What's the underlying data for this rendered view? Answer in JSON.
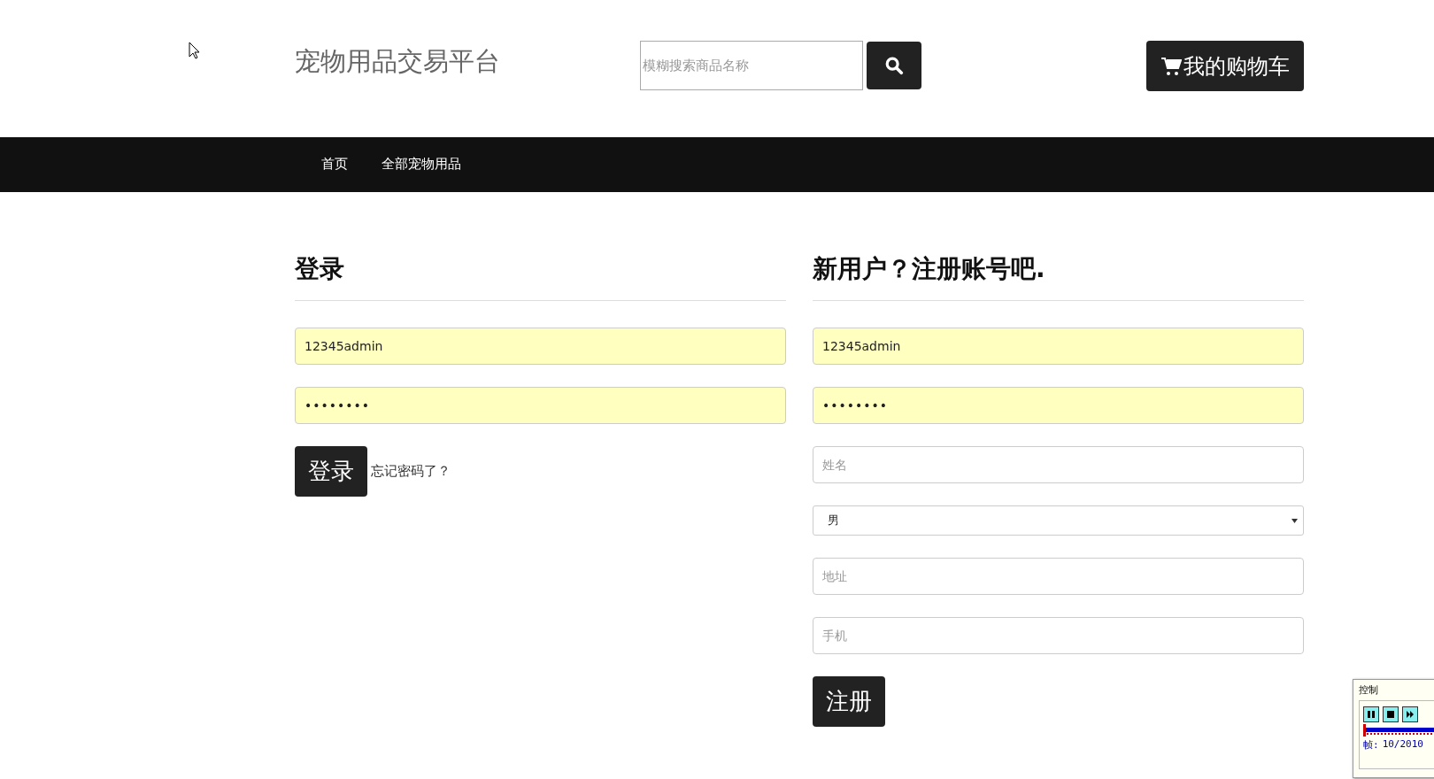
{
  "header": {
    "site_title": "宠物用品交易平台",
    "search": {
      "placeholder": "模糊搜索商品名称"
    },
    "cart_button": "我的购物车"
  },
  "nav": {
    "items": [
      {
        "label": "首页",
        "selected": false
      },
      {
        "label": "全部宠物用品",
        "selected": false
      }
    ]
  },
  "login": {
    "heading": "登录",
    "fields": [
      {
        "kind": "text",
        "value": "12345admin",
        "autofilled": true
      },
      {
        "kind": "password",
        "value": "••••••••",
        "autofilled": true
      }
    ],
    "submit": "登录",
    "forgot_link": "忘记密码了？"
  },
  "register": {
    "heading": "新用户？注册账号吧.",
    "fields": [
      {
        "kind": "text",
        "value": "12345admin",
        "autofilled": true
      },
      {
        "kind": "password",
        "value": "••••••••",
        "autofilled": true
      },
      {
        "kind": "text",
        "placeholder": "姓名",
        "autofilled": false
      },
      {
        "kind": "select",
        "value": "男",
        "autofilled": false
      },
      {
        "kind": "text",
        "placeholder": "地址",
        "autofilled": false
      },
      {
        "kind": "text",
        "placeholder": "手机",
        "autofilled": false
      }
    ],
    "submit": "注册"
  },
  "player_panel": {
    "title": "控制",
    "frame_label": "帧:",
    "frame_counter": "10/2010",
    "level": 0.005
  }
}
